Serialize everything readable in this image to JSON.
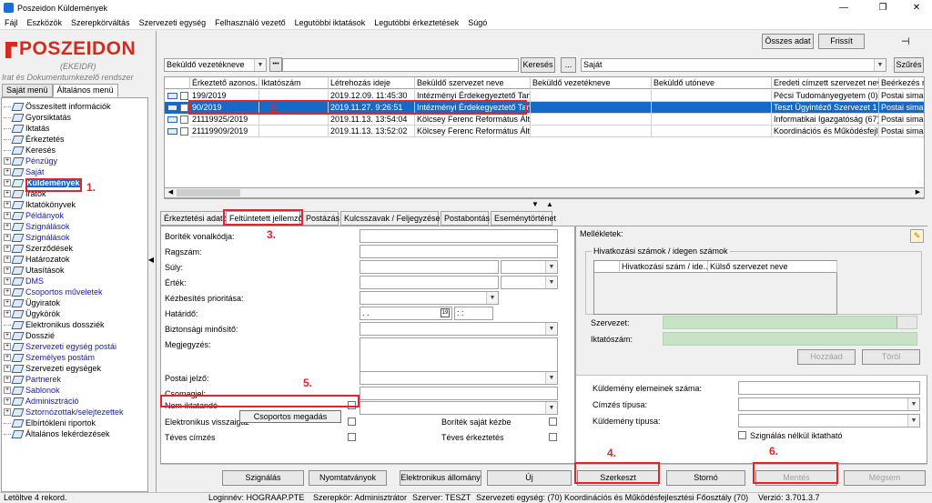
{
  "window": {
    "title": "Poszeidon Küldemények",
    "minimize": "—",
    "maximize": "❐",
    "close": "✕"
  },
  "menu": [
    "Fájl",
    "Eszközök",
    "Szerepkörváltás",
    "Szervezeti egység",
    "Felhasználó vezető",
    "Legutóbbi iktatások",
    "Legutóbbi érkeztetések",
    "Súgó"
  ],
  "logo": {
    "brand": "POSZEIDON",
    "sub1": "(EKEIDR)",
    "sub2": "Irat és Dokumentumkezelő rendszer"
  },
  "sidebar": {
    "tabs": [
      "Saját menü",
      "Általános menü"
    ],
    "tree": [
      {
        "label": "Összesített információk",
        "blue": false,
        "expand": false
      },
      {
        "label": "Gyorsiktatás",
        "blue": false,
        "expand": false
      },
      {
        "label": "Iktatás",
        "blue": false,
        "expand": false
      },
      {
        "label": "Érkeztetés",
        "blue": false,
        "expand": false
      },
      {
        "label": "Keresés",
        "blue": false,
        "expand": false
      },
      {
        "label": "Pénzügy",
        "blue": true,
        "expand": true
      },
      {
        "label": "Saját",
        "blue": true,
        "expand": true
      },
      {
        "label": "Küldemények",
        "blue": false,
        "expand": true,
        "selected": true
      },
      {
        "label": "Iratok",
        "blue": false,
        "expand": true
      },
      {
        "label": "Iktatókönyvek",
        "blue": false,
        "expand": true
      },
      {
        "label": "Példányok",
        "blue": true,
        "expand": true
      },
      {
        "label": "Szignálások",
        "blue": true,
        "expand": true
      },
      {
        "label": "Szignálások",
        "blue": true,
        "expand": true
      },
      {
        "label": "Szerződések",
        "blue": false,
        "expand": true
      },
      {
        "label": "Határozatok",
        "blue": false,
        "expand": true
      },
      {
        "label": "Utasítások",
        "blue": false,
        "expand": true
      },
      {
        "label": "DMS",
        "blue": true,
        "expand": true
      },
      {
        "label": "Csoportos műveletek",
        "blue": true,
        "expand": true
      },
      {
        "label": "Ügyiratok",
        "blue": false,
        "expand": true
      },
      {
        "label": "Ügykörök",
        "blue": false,
        "expand": true
      },
      {
        "label": "Elektronikus dossziék",
        "blue": false,
        "expand": false
      },
      {
        "label": "Dosszié",
        "blue": false,
        "expand": true
      },
      {
        "label": "Szervezeti egység postái",
        "blue": true,
        "expand": true
      },
      {
        "label": "Személyes postám",
        "blue": true,
        "expand": true
      },
      {
        "label": "Szervezeti egységek",
        "blue": false,
        "expand": true
      },
      {
        "label": "Partnerek",
        "blue": true,
        "expand": true
      },
      {
        "label": "Sablonok",
        "blue": true,
        "expand": true
      },
      {
        "label": "Adminisztráció",
        "blue": true,
        "expand": true
      },
      {
        "label": "Sztornózottak/selejtezettek",
        "blue": true,
        "expand": true
      },
      {
        "label": "Elbírtókleni riportok",
        "blue": false,
        "expand": false
      },
      {
        "label": "Általános lekérdezések",
        "blue": false,
        "expand": false
      }
    ]
  },
  "toolbar": {
    "all_data": "Összes adat",
    "refresh": "Frissít",
    "pin_icon": "pin-icon"
  },
  "search": {
    "field": "Beküldő vezetékneve",
    "dots": "•••",
    "value": "",
    "search_btn": "Keresés",
    "ellipsis_btn": "...",
    "filter": "Saját",
    "filter_btn": "Szűrés"
  },
  "grid": {
    "headers": [
      "Érkeztető azonos...",
      "Iktatószám",
      "Létrehozás ideje",
      "Beküldő szervezet neve",
      "Beküldő vezetékneve",
      "Beküldő utóneve",
      "Eredeti címzett szervezet neve",
      "Beérkezés mó"
    ],
    "rows": [
      {
        "cells": [
          "199/2019",
          "",
          "2019.12.09. 11:45:30",
          "Intézményi Érdekegyeztető Tanács",
          "",
          "",
          "Pécsi Tudományegyetem (0)",
          "Postai sima"
        ],
        "selected": false
      },
      {
        "cells": [
          "90/2019",
          "",
          "2019.11.27. 9:26:51",
          "Intézményi Érdekegyeztető Tanács",
          "",
          "",
          "Teszt Ügyintéző Szervezet 1",
          "Postai sima"
        ],
        "selected": true
      },
      {
        "cells": [
          "21119925/2019",
          "",
          "2019.11.13. 13:54:04",
          "Kölcsey Ferenc Református Általános",
          "",
          "",
          "Informatikai Igazgatóság (67)",
          "Postai sima"
        ],
        "selected": false
      },
      {
        "cells": [
          "21119909/2019",
          "",
          "2019.11.13. 13:52:02",
          "Kölcsey Ferenc Református Általános",
          "",
          "",
          "Koordinációs és Működésfejlesztés",
          "Postai sima"
        ],
        "selected": false
      }
    ]
  },
  "tabs": [
    "Érkeztetési adatok",
    "Feltüntetett jellemzők",
    "Postázás",
    "Kulcsszavak / Feljegyzések",
    "Postabontás",
    "Eseménytörténet"
  ],
  "form": {
    "boritek": "Boríték vonalkódja:",
    "ragszam": "Ragszám:",
    "suly": "Súly:",
    "ertek": "Érték:",
    "kezbesites": "Kézbesítés prioritása:",
    "hatarido": "Határidő:",
    "hatarido_val": ". .",
    "hatarido_time": ": :",
    "biztonsagi": "Biztonsági minősítő:",
    "megjegyzes": "Megjegyzés:",
    "postai_jelzo": "Postai jelző:",
    "csomagjel": "Csomagjel:",
    "nem_iktatando": "Nem iktatandó",
    "elektronikus": "Elektronikus visszaigaz",
    "csoportos_tooltip": "Csoportos megadás",
    "teves_cimzes": "Téves címzés",
    "boritek_sajat": "Boríték saját kézbe",
    "teves_erkeztetes": "Téves érkeztetés"
  },
  "right": {
    "mellekletek": "Mellékletek:",
    "group": "Hivatkozási számok / idegen számok",
    "col1": "Hivatkozási szám / ide...",
    "col2": "Külső szervezet neve",
    "szervezet": "Szervezet:",
    "iktatoszam": "Iktatószám:",
    "hozzaad": "Hozzáad",
    "torol": "Töröl",
    "elemek": "Küldemény elemeinek száma:",
    "cimzes": "Címzés típusa:",
    "kuldemeny_tipus": "Küldemény típusa:",
    "szignalas": "Szignálás nélkül iktatható"
  },
  "buttons": {
    "szignalas": "Szignálás",
    "nyomtatvanyok": "Nyomtatványok",
    "elektronikus": "Elektronikus állomány",
    "uj": "Új",
    "szerkeszt": "Szerkeszt",
    "storno": "Stornó",
    "mentes": "Mentés",
    "megsem": "Mégsem"
  },
  "annotations": [
    "1.",
    "2.",
    "3.",
    "4.",
    "5.",
    "6."
  ],
  "status": {
    "left": "Letöltve 4 rekord.",
    "login": "Loginnév: HOGRAAP.PTE",
    "role": "Szerepkör: Adminisztrátor",
    "server": "Szerver: TESZT",
    "unit": "Szervezeti egység: (70) Koordinációs és Működésfejlesztési Főosztály (70)",
    "version": "Verzió: 3.701.3.7"
  }
}
